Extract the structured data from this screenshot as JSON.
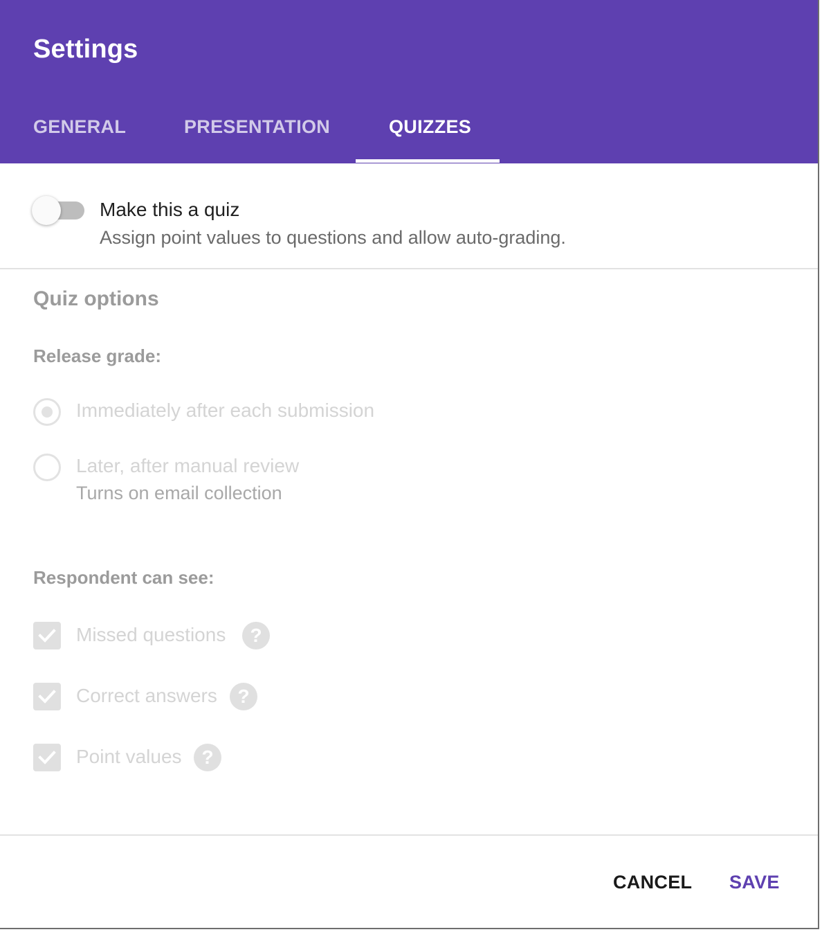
{
  "dialog": {
    "title": "Settings"
  },
  "tabs": [
    {
      "label": "GENERAL",
      "active": false
    },
    {
      "label": "PRESENTATION",
      "active": false
    },
    {
      "label": "QUIZZES",
      "active": true
    }
  ],
  "quiz_toggle": {
    "label": "Make this a quiz",
    "description": "Assign point values to questions and allow auto-grading.",
    "enabled": false
  },
  "quiz_options": {
    "title": "Quiz options",
    "release_grade": {
      "heading": "Release grade:",
      "options": [
        {
          "label": "Immediately after each submission",
          "selected": true
        },
        {
          "label": "Later, after manual review",
          "sublabel": "Turns on email collection",
          "selected": false
        }
      ]
    },
    "respondent_can_see": {
      "heading": "Respondent can see:",
      "items": [
        {
          "label": "Missed questions",
          "checked": true,
          "help_icon": "?"
        },
        {
          "label": "Correct answers",
          "checked": true,
          "help_icon": "?"
        },
        {
          "label": "Point values",
          "checked": true,
          "help_icon": "?"
        }
      ]
    }
  },
  "footer": {
    "cancel_label": "CANCEL",
    "save_label": "SAVE"
  },
  "colors": {
    "accent": "#5e40b0",
    "disabled_text": "#d4d4d4"
  }
}
